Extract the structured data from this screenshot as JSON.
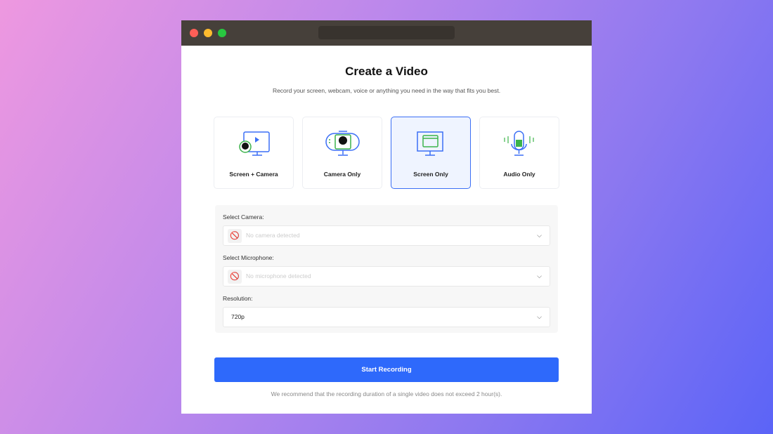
{
  "title": "Create a Video",
  "subtitle": "Record your screen, webcam, voice or anything you need in the way that fits you best.",
  "modes": [
    {
      "label": "Screen + Camera",
      "icon": "screen-camera-icon",
      "selected": false
    },
    {
      "label": "Camera Only",
      "icon": "webcam-icon",
      "selected": false
    },
    {
      "label": "Screen Only",
      "icon": "monitor-icon",
      "selected": true
    },
    {
      "label": "Audio Only",
      "icon": "microphone-icon",
      "selected": false
    }
  ],
  "camera": {
    "label": "Select Camera:",
    "value": "No camera detected",
    "icon": "camera-off-icon"
  },
  "microphone": {
    "label": "Select Microphone:",
    "value": "No microphone detected",
    "icon": "mic-off-icon"
  },
  "resolution": {
    "label": "Resolution:",
    "value": "720p"
  },
  "start_label": "Start Recording",
  "note": "We recommend that the recording duration of a single video does not exceed 2 hour(s).",
  "colors": {
    "accent": "#2e69fb",
    "green": "#3cb34a"
  }
}
